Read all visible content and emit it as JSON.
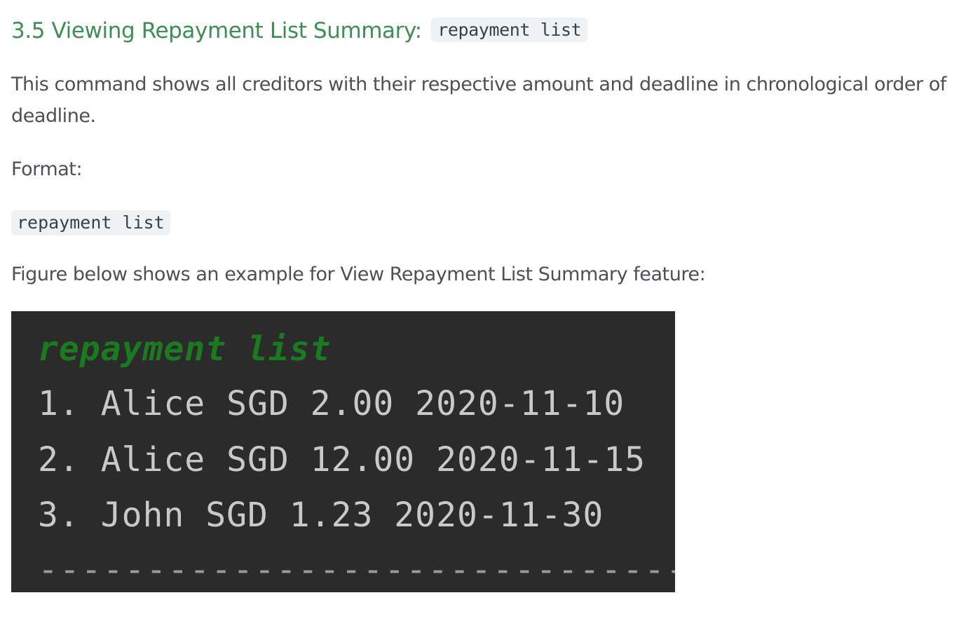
{
  "section": {
    "heading": "3.5 Viewing Repayment List Summary:",
    "heading_code": "repayment list",
    "description": "This command shows all creditors with their respective amount and deadline in chronological order of deadline.",
    "format_label": "Format:",
    "format_code": "repayment list",
    "figure_caption": "Figure below shows an example for View Repayment List Summary feature:"
  },
  "terminal": {
    "command": "repayment list",
    "rows": [
      "1. Alice SGD 2.00 2020-11-10",
      "2. Alice SGD 12.00 2020-11-15",
      "3. John SGD 1.23 2020-11-30"
    ],
    "separator": "------------------------------------------",
    "colors": {
      "background": "#2b2b2b",
      "command": "#1b7a1f",
      "text": "#c9c9c9"
    }
  },
  "colors": {
    "heading": "#3f8f55",
    "body_text": "#4b5157",
    "code_background": "#eef2f5"
  }
}
